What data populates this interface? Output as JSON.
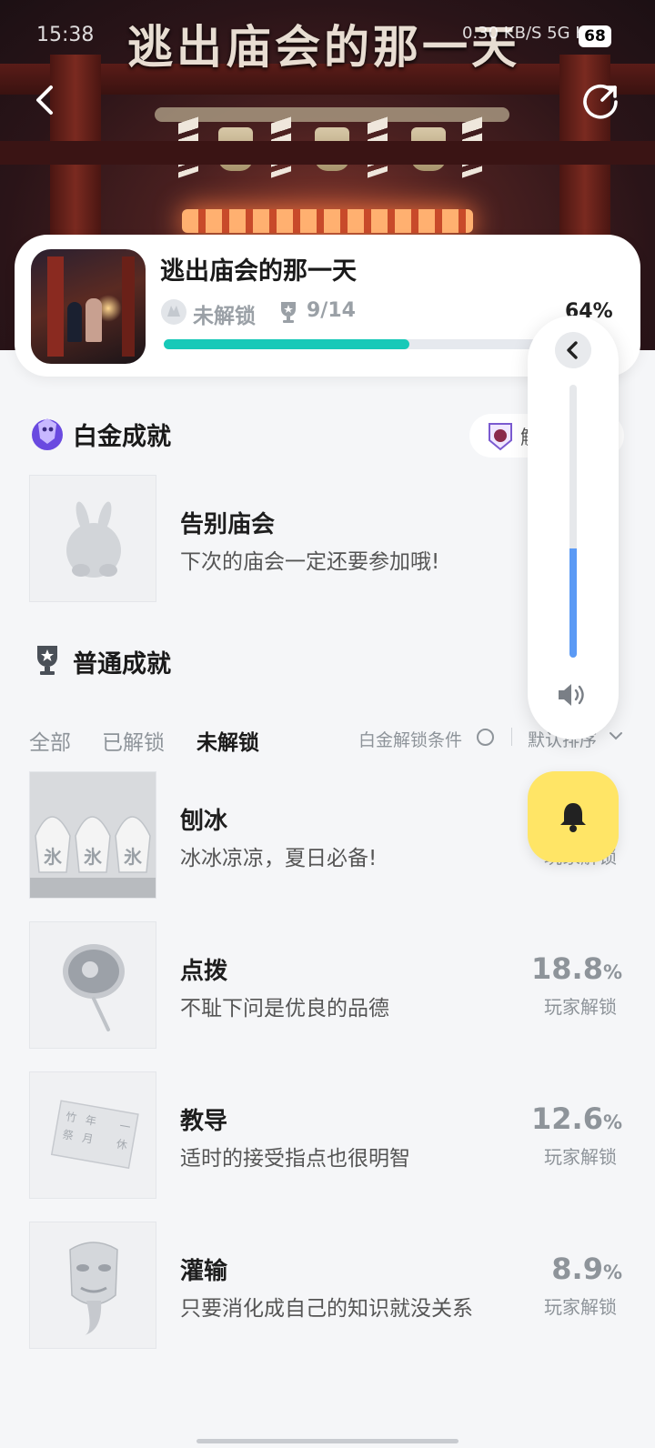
{
  "status_bar": {
    "time": "15:38",
    "network": "0.30 KB/S  5G HD",
    "battery": "68"
  },
  "hero": {
    "banner_title": "逃出庙会的那一天"
  },
  "game": {
    "title": "逃出庙会的那一天",
    "lock_status": "未解锁",
    "progress": "9/14",
    "percent": "64%",
    "progress_fraction": 0.643
  },
  "platinum": {
    "section_title": "白金成就",
    "pill_text": "解",
    "achievement": {
      "name": "告别庙会",
      "desc": "下次的庙会一定还要参加哦!"
    }
  },
  "normal": {
    "section_title": "普通成就",
    "tabs": [
      "全部",
      "已解锁",
      "未解锁"
    ],
    "active_tab": 2,
    "condition_label": "白金解锁条件",
    "sort_label": "默认排序",
    "achievements": [
      {
        "name": "刨冰",
        "desc": "冰冰凉凉，夏日必备!",
        "pct": "",
        "pct_unit": "%",
        "sub": "玩家解锁"
      },
      {
        "name": "点拨",
        "desc": "不耻下问是优良的品德",
        "pct": "18.8",
        "pct_unit": "%",
        "sub": "玩家解锁"
      },
      {
        "name": "教导",
        "desc": "适时的接受指点也很明智",
        "pct": "12.6",
        "pct_unit": "%",
        "sub": "玩家解锁"
      },
      {
        "name": "灌输",
        "desc": "只要消化成自己的知识就没关系",
        "pct": "8.9",
        "pct_unit": "%",
        "sub": "玩家解锁"
      }
    ]
  },
  "volume": {
    "level": 0.4
  },
  "colors": {
    "progress": "#17c9b8",
    "volume": "#5b9af5",
    "bell": "#ffe566"
  }
}
